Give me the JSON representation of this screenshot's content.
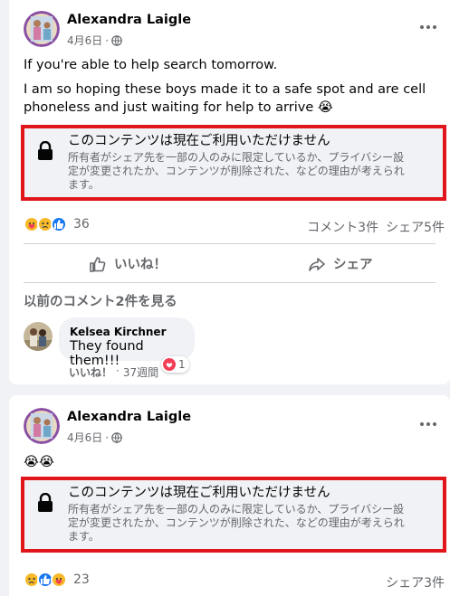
{
  "posts": [
    {
      "author": "Alexandra Laigle",
      "date": "4月6日",
      "separator": "·",
      "icons": {
        "privacy": "globe-icon",
        "menu": "more-options-icon"
      },
      "text_lines": [
        "If you're able to help search tomorrow.",
        "I am so hoping these boys made it to a safe spot and are cell",
        "phoneless and just waiting for help to arrive"
      ],
      "emoji": "😭",
      "notice": {
        "title": "このコンテンツは現在ご利用いただけません",
        "body_lines": [
          "所有者がシェア先を一部の人のみに限定しているか、プライバシー設",
          "定が変更されたか、コンテンツが削除された、などの理由が考えられ",
          "ます。"
        ]
      },
      "reaction_icons": [
        "care-reaction-icon",
        "sad-reaction-icon",
        "like-reaction-icon"
      ],
      "reaction_count": "36",
      "comment_count": "コメント3件",
      "share_count": "シェア5件",
      "actions": {
        "like": "いいね！",
        "share": "シェア"
      },
      "comments": {
        "previous_label": "以前のコメント2件を見る",
        "items": [
          {
            "name": "Kelsea Kirchner",
            "text": "They found them!!!",
            "reaction_count": "1",
            "like_label": "いいね！",
            "separator": "·",
            "time": "37週間"
          }
        ]
      }
    },
    {
      "author": "Alexandra Laigle",
      "date": "4月6日",
      "separator": "·",
      "icons": {
        "privacy": "globe-icon",
        "menu": "more-options-icon"
      },
      "emoji_line": "😭😭",
      "notice": {
        "title": "このコンテンツは現在ご利用いただけません",
        "body_lines": [
          "所有者がシェア先を一部の人のみに限定しているか、プライバシー設",
          "定が変更されたか、コンテンツが削除された、などの理由が考えられ",
          "ます。"
        ]
      },
      "reaction_icons": [
        "sad-reaction-icon",
        "like-reaction-icon",
        "care-reaction-icon"
      ],
      "reaction_count": "23",
      "share_count": "シェア3件"
    }
  ],
  "colors": {
    "notice_border": "#e1151c",
    "like_blue": "#1877f2",
    "reaction_yellow": "#f7b928",
    "heart_red": "#f33e58",
    "secondary_text": "#65676b"
  }
}
